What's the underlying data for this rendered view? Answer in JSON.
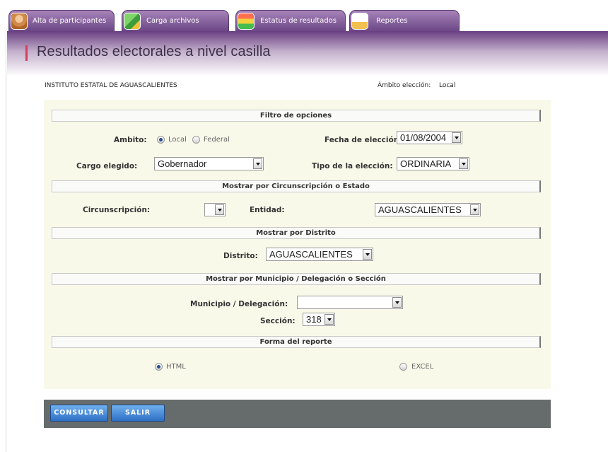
{
  "tabs": [
    {
      "label": "Alta de participantes",
      "icon": "person-icon"
    },
    {
      "label": "Carga archivos",
      "icon": "folder-icon"
    },
    {
      "label": "Estatus de resultados",
      "icon": "traffic-light-icon"
    },
    {
      "label": "Reportes",
      "icon": "report-icon"
    }
  ],
  "header": {
    "title": "Resultados electorales a nivel casilla"
  },
  "info": {
    "institute": "INSTITUTO ESTATAL DE AGUASCALIENTES",
    "ambito_label": "Ámbito elección:",
    "ambito_value": "Local"
  },
  "filters": {
    "header": "Filtro de opciones",
    "ambito_label": "Ambito:",
    "ambito_options": [
      {
        "label": "Local",
        "selected": true
      },
      {
        "label": "Federal",
        "selected": false
      }
    ],
    "fecha_label": "Fecha de elección:",
    "fecha_value": "01/08/2004",
    "cargo_label": "Cargo elegido:",
    "cargo_value": "Gobernador",
    "tipo_label": "Tipo de la elección:",
    "tipo_value": "ORDINARIA"
  },
  "circunscripcion": {
    "header": "Mostrar por Circunscripción o Estado",
    "circ_label": "Circunscripción:",
    "circ_value": "",
    "entidad_label": "Entidad:",
    "entidad_value": "AGUASCALIENTES"
  },
  "distrito": {
    "header": "Mostrar por Distrito",
    "label": "Distrito:",
    "value": "AGUASCALIENTES"
  },
  "municipio": {
    "header": "Mostrar por Municipio / Delegación o Sección",
    "mun_label": "Municipio / Delegación:",
    "mun_value": "",
    "seccion_label": "Sección:",
    "seccion_value": "318"
  },
  "forma": {
    "header": "Forma del reporte",
    "options": [
      {
        "label": "HTML",
        "selected": true
      },
      {
        "label": "EXCEL",
        "selected": false
      }
    ]
  },
  "actions": {
    "consultar": "CONSULTAR",
    "salir": "SALIR"
  },
  "colors": {
    "tab_purple": "#6b4785",
    "accent_red": "#d53f5c",
    "button_blue": "#2d6fc4",
    "panel_bg": "#f9f9ea",
    "action_bar": "#666b6b"
  }
}
